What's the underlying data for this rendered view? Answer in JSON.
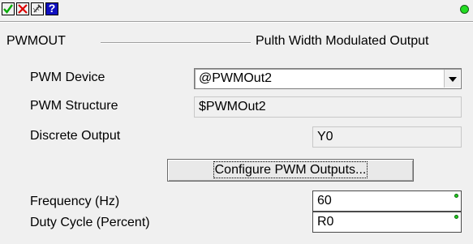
{
  "toolbar": {
    "buttons": [
      {
        "icon": "checkmark-icon",
        "color": "#00aa00"
      },
      {
        "icon": "x-icon",
        "color": "#dd0000"
      },
      {
        "icon": "edit-icon"
      },
      {
        "icon": "help-icon",
        "label": "?"
      }
    ],
    "status_color": "#22dd22"
  },
  "header": {
    "name": "PWMOUT",
    "description": "Pulth Width Modulated Output"
  },
  "fields": {
    "pwm_device": {
      "label": "PWM Device",
      "value": "@PWMOut2"
    },
    "pwm_structure": {
      "label": "PWM Structure",
      "value": "$PWMOut2"
    },
    "discrete_output": {
      "label": "Discrete Output",
      "value": "Y0"
    },
    "configure_button": "Configure PWM Outputs...",
    "frequency": {
      "label": "Frequency (Hz)",
      "value": "60"
    },
    "duty_cycle": {
      "label": "Duty Cycle (Percent)",
      "value": "R0"
    }
  }
}
